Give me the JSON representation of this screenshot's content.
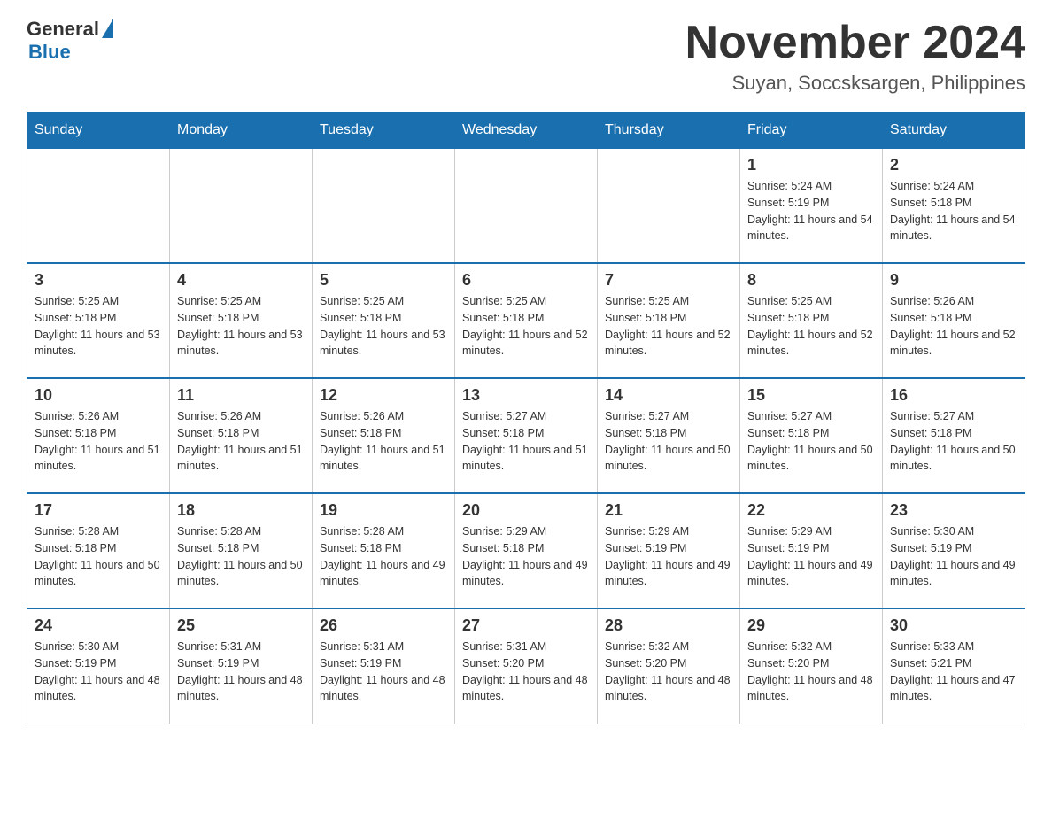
{
  "header": {
    "logo": {
      "general": "General",
      "blue": "Blue"
    },
    "title": "November 2024",
    "subtitle": "Suyan, Soccsksargen, Philippines"
  },
  "days_of_week": [
    "Sunday",
    "Monday",
    "Tuesday",
    "Wednesday",
    "Thursday",
    "Friday",
    "Saturday"
  ],
  "weeks": [
    [
      {
        "day": "",
        "info": ""
      },
      {
        "day": "",
        "info": ""
      },
      {
        "day": "",
        "info": ""
      },
      {
        "day": "",
        "info": ""
      },
      {
        "day": "",
        "info": ""
      },
      {
        "day": "1",
        "info": "Sunrise: 5:24 AM\nSunset: 5:19 PM\nDaylight: 11 hours and 54 minutes."
      },
      {
        "day": "2",
        "info": "Sunrise: 5:24 AM\nSunset: 5:18 PM\nDaylight: 11 hours and 54 minutes."
      }
    ],
    [
      {
        "day": "3",
        "info": "Sunrise: 5:25 AM\nSunset: 5:18 PM\nDaylight: 11 hours and 53 minutes."
      },
      {
        "day": "4",
        "info": "Sunrise: 5:25 AM\nSunset: 5:18 PM\nDaylight: 11 hours and 53 minutes."
      },
      {
        "day": "5",
        "info": "Sunrise: 5:25 AM\nSunset: 5:18 PM\nDaylight: 11 hours and 53 minutes."
      },
      {
        "day": "6",
        "info": "Sunrise: 5:25 AM\nSunset: 5:18 PM\nDaylight: 11 hours and 52 minutes."
      },
      {
        "day": "7",
        "info": "Sunrise: 5:25 AM\nSunset: 5:18 PM\nDaylight: 11 hours and 52 minutes."
      },
      {
        "day": "8",
        "info": "Sunrise: 5:25 AM\nSunset: 5:18 PM\nDaylight: 11 hours and 52 minutes."
      },
      {
        "day": "9",
        "info": "Sunrise: 5:26 AM\nSunset: 5:18 PM\nDaylight: 11 hours and 52 minutes."
      }
    ],
    [
      {
        "day": "10",
        "info": "Sunrise: 5:26 AM\nSunset: 5:18 PM\nDaylight: 11 hours and 51 minutes."
      },
      {
        "day": "11",
        "info": "Sunrise: 5:26 AM\nSunset: 5:18 PM\nDaylight: 11 hours and 51 minutes."
      },
      {
        "day": "12",
        "info": "Sunrise: 5:26 AM\nSunset: 5:18 PM\nDaylight: 11 hours and 51 minutes."
      },
      {
        "day": "13",
        "info": "Sunrise: 5:27 AM\nSunset: 5:18 PM\nDaylight: 11 hours and 51 minutes."
      },
      {
        "day": "14",
        "info": "Sunrise: 5:27 AM\nSunset: 5:18 PM\nDaylight: 11 hours and 50 minutes."
      },
      {
        "day": "15",
        "info": "Sunrise: 5:27 AM\nSunset: 5:18 PM\nDaylight: 11 hours and 50 minutes."
      },
      {
        "day": "16",
        "info": "Sunrise: 5:27 AM\nSunset: 5:18 PM\nDaylight: 11 hours and 50 minutes."
      }
    ],
    [
      {
        "day": "17",
        "info": "Sunrise: 5:28 AM\nSunset: 5:18 PM\nDaylight: 11 hours and 50 minutes."
      },
      {
        "day": "18",
        "info": "Sunrise: 5:28 AM\nSunset: 5:18 PM\nDaylight: 11 hours and 50 minutes."
      },
      {
        "day": "19",
        "info": "Sunrise: 5:28 AM\nSunset: 5:18 PM\nDaylight: 11 hours and 49 minutes."
      },
      {
        "day": "20",
        "info": "Sunrise: 5:29 AM\nSunset: 5:18 PM\nDaylight: 11 hours and 49 minutes."
      },
      {
        "day": "21",
        "info": "Sunrise: 5:29 AM\nSunset: 5:19 PM\nDaylight: 11 hours and 49 minutes."
      },
      {
        "day": "22",
        "info": "Sunrise: 5:29 AM\nSunset: 5:19 PM\nDaylight: 11 hours and 49 minutes."
      },
      {
        "day": "23",
        "info": "Sunrise: 5:30 AM\nSunset: 5:19 PM\nDaylight: 11 hours and 49 minutes."
      }
    ],
    [
      {
        "day": "24",
        "info": "Sunrise: 5:30 AM\nSunset: 5:19 PM\nDaylight: 11 hours and 48 minutes."
      },
      {
        "day": "25",
        "info": "Sunrise: 5:31 AM\nSunset: 5:19 PM\nDaylight: 11 hours and 48 minutes."
      },
      {
        "day": "26",
        "info": "Sunrise: 5:31 AM\nSunset: 5:19 PM\nDaylight: 11 hours and 48 minutes."
      },
      {
        "day": "27",
        "info": "Sunrise: 5:31 AM\nSunset: 5:20 PM\nDaylight: 11 hours and 48 minutes."
      },
      {
        "day": "28",
        "info": "Sunrise: 5:32 AM\nSunset: 5:20 PM\nDaylight: 11 hours and 48 minutes."
      },
      {
        "day": "29",
        "info": "Sunrise: 5:32 AM\nSunset: 5:20 PM\nDaylight: 11 hours and 48 minutes."
      },
      {
        "day": "30",
        "info": "Sunrise: 5:33 AM\nSunset: 5:21 PM\nDaylight: 11 hours and 47 minutes."
      }
    ]
  ]
}
